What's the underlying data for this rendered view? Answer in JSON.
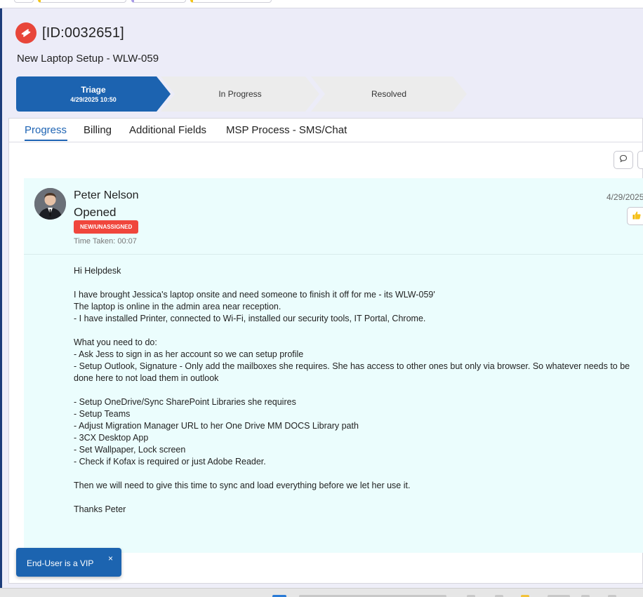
{
  "ticket": {
    "id": "[ID:0032651]",
    "title": "New Laptop Setup - WLW-059"
  },
  "stages": [
    {
      "label": "Triage",
      "sub": "4/29/2025 10:50",
      "active": true
    },
    {
      "label": "In Progress",
      "sub": "",
      "active": false
    },
    {
      "label": "Resolved",
      "sub": "",
      "active": false
    }
  ],
  "colors": {
    "active_stage": "#1c63b0",
    "inactive_stage": "#ececec",
    "ticket_icon": "#e8463a",
    "status_badge": "#f0463c",
    "accent_tab": "#1e64b4",
    "entry_background": "#ebfdfd",
    "vip_toast": "#1c64b0"
  },
  "tabs": [
    {
      "label": "Progress",
      "active": true
    },
    {
      "label": "Billing",
      "active": false
    },
    {
      "label": "Additional Fields",
      "active": false
    },
    {
      "label": "MSP Process - SMS/Chat",
      "active": false
    }
  ],
  "toolbar": {
    "comment_icon": "speech-bubble-icon"
  },
  "entry": {
    "author": "Peter Nelson",
    "action": "Opened",
    "status_badge": "NEW/UNASSIGNED",
    "time_taken": "Time Taken: 00:07",
    "date": "4/29/2025",
    "like_icon": "thumbs-up-icon",
    "body": [
      "Hi Helpdesk",
      "",
      "I have brought Jessica's laptop onsite and need someone to finish it off for me - its WLW-059'",
      "The laptop is online in the admin area near reception.",
      "- I have installed Printer, connected to Wi-Fi, installed our security tools, IT Portal, Chrome.",
      "",
      "What you need to do:",
      "- Ask Jess to sign in as her account so we can setup profile",
      "- Setup Outlook, Signature - Only add the mailboxes she requires. She has access to other ones but only via browser. So whatever needs to be done here to not load them in outlook",
      "",
      "- Setup OneDrive/Sync SharePoint Libraries she requires",
      "- Setup Teams",
      "- Adjust Migration Manager URL to her One Drive MM DOCS Library path",
      "- 3CX Desktop App",
      "- Set Wallpaper, Lock screen",
      "- Check if Kofax is required or just Adobe Reader.",
      "",
      "Then we will need to give this time to sync and load everything before we let her use it.",
      "",
      "Thanks Peter"
    ]
  },
  "vip_toast": {
    "text": "End-User is a VIP",
    "close_label": "×"
  }
}
